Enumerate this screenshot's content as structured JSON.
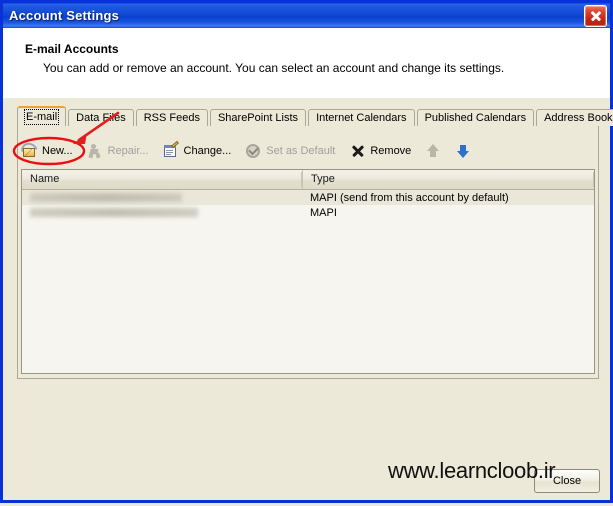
{
  "window": {
    "title": "Account Settings",
    "close_icon": "close-icon"
  },
  "header": {
    "title": "E-mail Accounts",
    "description": "You can add or remove an account. You can select an account and change its settings."
  },
  "tabs": [
    {
      "label": "E-mail",
      "active": true
    },
    {
      "label": "Data Files",
      "active": false
    },
    {
      "label": "RSS Feeds",
      "active": false
    },
    {
      "label": "SharePoint Lists",
      "active": false
    },
    {
      "label": "Internet Calendars",
      "active": false
    },
    {
      "label": "Published Calendars",
      "active": false
    },
    {
      "label": "Address Books",
      "active": false
    }
  ],
  "toolbar": {
    "new_label": "New...",
    "repair_label": "Repair...",
    "change_label": "Change...",
    "set_default_label": "Set as Default",
    "remove_label": "Remove",
    "move_up_icon": "arrow-up-icon",
    "move_down_icon": "arrow-down-icon"
  },
  "list": {
    "columns": [
      "Name",
      "Type"
    ],
    "rows": [
      {
        "name": "",
        "type": "MAPI (send from this account by default)",
        "selected": true
      },
      {
        "name": "",
        "type": "MAPI",
        "selected": false
      }
    ]
  },
  "footer": {
    "close_label": "Close"
  },
  "watermark": {
    "text": "www.learncloob.ir"
  },
  "annotation": {
    "highlight_color": "#e81010",
    "highlight_target": "new-button",
    "arrow_color": "#e02020"
  }
}
